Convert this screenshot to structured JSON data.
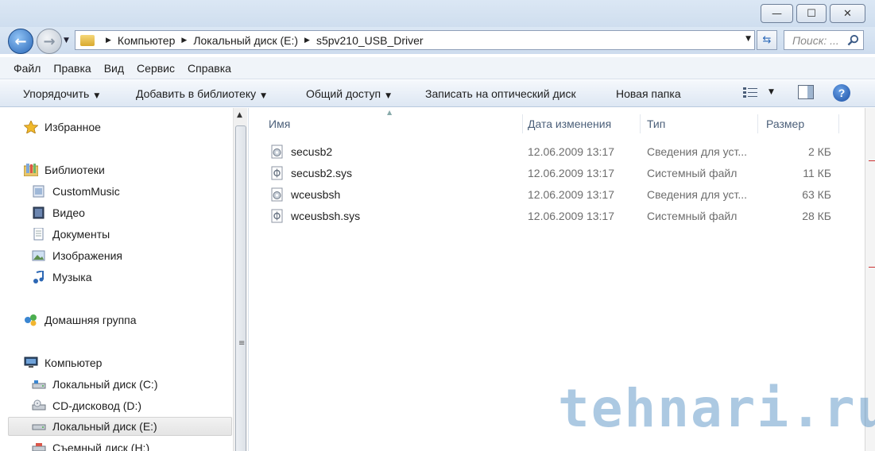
{
  "window": {
    "min_glyph": "—",
    "max_glyph": "☐",
    "close_glyph": "✕"
  },
  "address": {
    "crumbs": [
      "Компьютер",
      "Локальный диск (E:)",
      "s5pv210_USB_Driver"
    ],
    "search_placeholder": "Поиск: ..."
  },
  "menubar": {
    "items": [
      "Файл",
      "Правка",
      "Вид",
      "Сервис",
      "Справка"
    ]
  },
  "toolbar": {
    "organize": "Упорядочить",
    "add_to_library": "Добавить в библиотеку",
    "share": "Общий доступ",
    "burn": "Записать на оптический диск",
    "new_folder": "Новая папка",
    "help": "?"
  },
  "navpane": {
    "favorites": "Избранное",
    "libraries": "Библиотеки",
    "library_items": [
      "CustomMusic",
      "Видео",
      "Документы",
      "Изображения",
      "Музыка"
    ],
    "homegroup": "Домашняя группа",
    "computer": "Компьютер",
    "drives": [
      "Локальный диск (C:)",
      "CD-дисковод (D:)",
      "Локальный диск (E:)",
      "Съемный диск (H:)"
    ]
  },
  "columns": {
    "name": "Имя",
    "date": "Дата изменения",
    "type": "Тип",
    "size": "Размер"
  },
  "files": [
    {
      "name": "secusb2",
      "date": "12.06.2009 13:17",
      "type": "Сведения для уст...",
      "size": "2 КБ",
      "icon": "setup-info-icon"
    },
    {
      "name": "secusb2.sys",
      "date": "12.06.2009 13:17",
      "type": "Системный файл",
      "size": "11 КБ",
      "icon": "system-file-icon"
    },
    {
      "name": "wceusbsh",
      "date": "12.06.2009 13:17",
      "type": "Сведения для уст...",
      "size": "63 КБ",
      "icon": "setup-info-icon"
    },
    {
      "name": "wceusbsh.sys",
      "date": "12.06.2009 13:17",
      "type": "Системный файл",
      "size": "28 КБ",
      "icon": "system-file-icon"
    }
  ],
  "watermark": "tehnari.ru"
}
